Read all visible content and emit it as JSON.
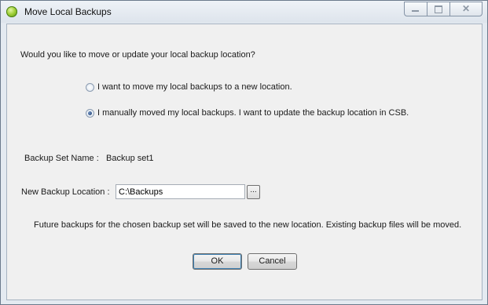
{
  "window": {
    "title": "Move Local Backups",
    "close_glyph": "✕"
  },
  "prompt": "Would you like to move or update your local backup location?",
  "options": [
    {
      "label": "I want to move my local backups to a new location.",
      "checked": false
    },
    {
      "label": "I manually moved my local backups. I want to update the backup location in CSB.",
      "checked": true
    }
  ],
  "backup_set": {
    "label": "Backup Set Name :",
    "value": "Backup set1"
  },
  "location": {
    "label": "New Backup Location :",
    "value": "C:\\Backups",
    "browse_label": "..."
  },
  "info": "Future backups for the chosen backup set will be saved to the new location. Existing backup files will be moved.",
  "buttons": {
    "ok": "OK",
    "cancel": "Cancel"
  },
  "colors": {
    "title_bg": "#dde4ec",
    "panel_bg": "#f0f0f0",
    "frame": "#e4eaf1"
  }
}
